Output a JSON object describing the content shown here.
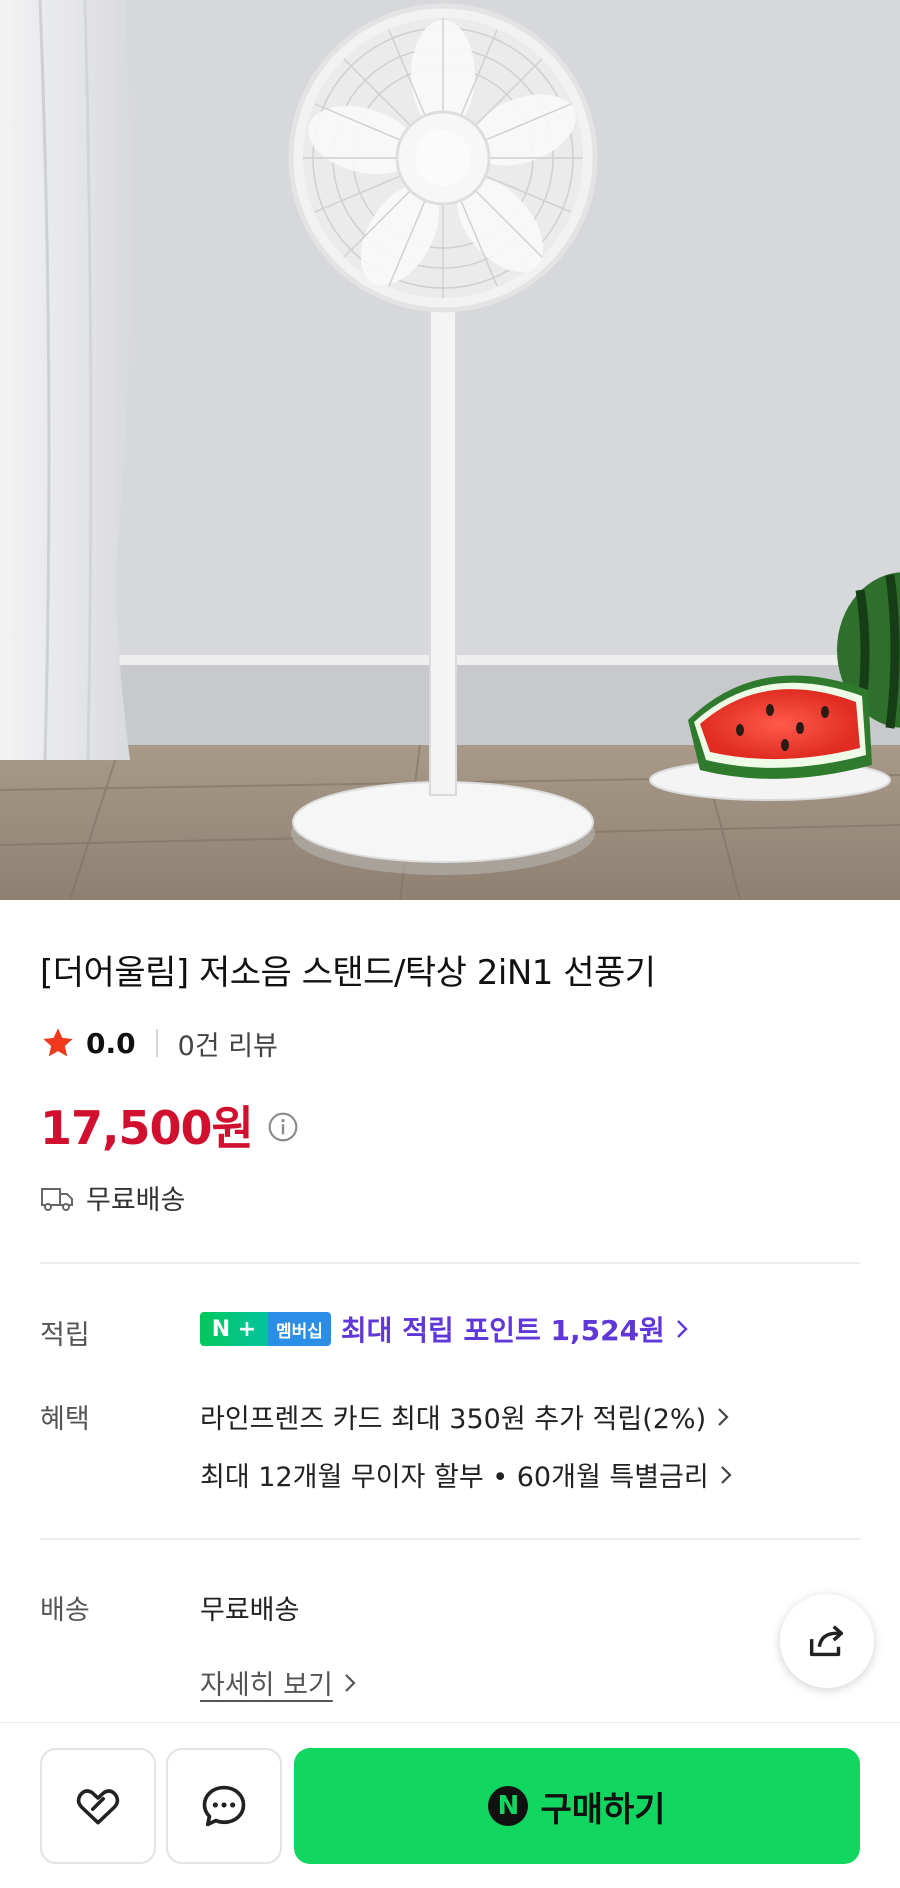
{
  "product": {
    "title": "[더어울림] 저소음 스탠드/탁상 2iN1 선풍기",
    "rating": "0.0",
    "review_count": "0건 리뷰",
    "price": "17,500원",
    "shipping_badge": "무료배송"
  },
  "details": {
    "points": {
      "label": "적립",
      "badge_left": "N +",
      "badge_right": "멤버십",
      "text": "최대 적립 포인트 1,524원"
    },
    "benefits": {
      "label": "혜택",
      "line1": "라인프렌즈 카드 최대 350원 추가 적립(2%)",
      "line2": "최대 12개월 무이자 할부 • 60개월 특별금리"
    },
    "delivery": {
      "label": "배송",
      "value": "무료배송",
      "detail_link": "자세히 보기"
    }
  },
  "bottom_bar": {
    "buy_label": "구매하기",
    "buy_logo": "N"
  },
  "icons": {
    "rating": "star-icon",
    "price_info": "info-icon",
    "shipping": "truck-icon",
    "share": "share-icon",
    "wishlist": "heart-icon",
    "chat": "chat-icon"
  },
  "colors": {
    "price": "#d0102e",
    "star": "#f03a1e",
    "point_text": "#6038d9",
    "buy_button": "#11d65f"
  }
}
